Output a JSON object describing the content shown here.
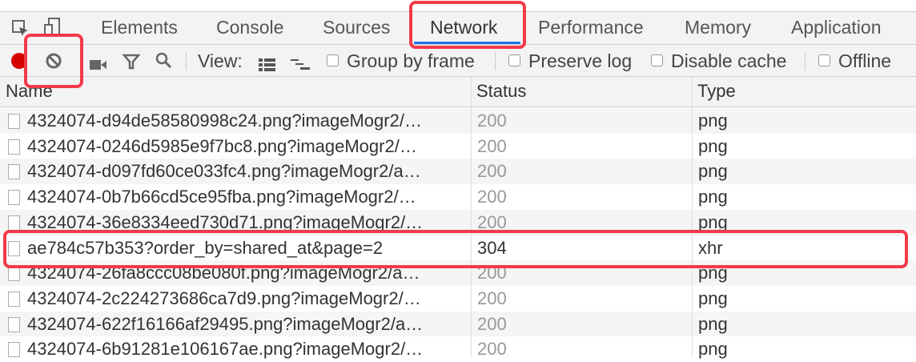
{
  "tabs": [
    "Elements",
    "Console",
    "Sources",
    "Network",
    "Performance",
    "Memory",
    "Application"
  ],
  "active_tab": "Network",
  "toolbar": {
    "view_label": "View:",
    "group_by_frame": "Group by frame",
    "preserve_log": "Preserve log",
    "disable_cache": "Disable cache",
    "offline": "Offline",
    "record_color": "#d50000"
  },
  "columns": [
    "Name",
    "Status",
    "Type"
  ],
  "rows": [
    {
      "name": "4324074-d94de58580998c24.png?imageMogr2/…",
      "status": "200",
      "type": "png"
    },
    {
      "name": "4324074-0246d5985e9f7bc8.png?imageMogr2/…",
      "status": "200",
      "type": "png"
    },
    {
      "name": "4324074-d097fd60ce033fc4.png?imageMogr2/a…",
      "status": "200",
      "type": "png"
    },
    {
      "name": "4324074-0b7b66cd5ce95fba.png?imageMogr2/…",
      "status": "200",
      "type": "png"
    },
    {
      "name": "4324074-36e8334eed730d71.png?imageMogr2/…",
      "status": "200",
      "type": "png"
    },
    {
      "name": "ae784c57b353?order_by=shared_at&page=2",
      "status": "304",
      "type": "xhr"
    },
    {
      "name": "4324074-26fa8ccc08be080f.png?imageMogr2/a…",
      "status": "200",
      "type": "png"
    },
    {
      "name": "4324074-2c224273686ca7d9.png?imageMogr2/…",
      "status": "200",
      "type": "png"
    },
    {
      "name": "4324074-622f16166af29495.png?imageMogr2/a…",
      "status": "200",
      "type": "png"
    },
    {
      "name": "4324074-6b91281e106167ae.png?imageMogr2/…",
      "status": "200",
      "type": "png"
    }
  ],
  "annotation_color": "#f23a4a"
}
